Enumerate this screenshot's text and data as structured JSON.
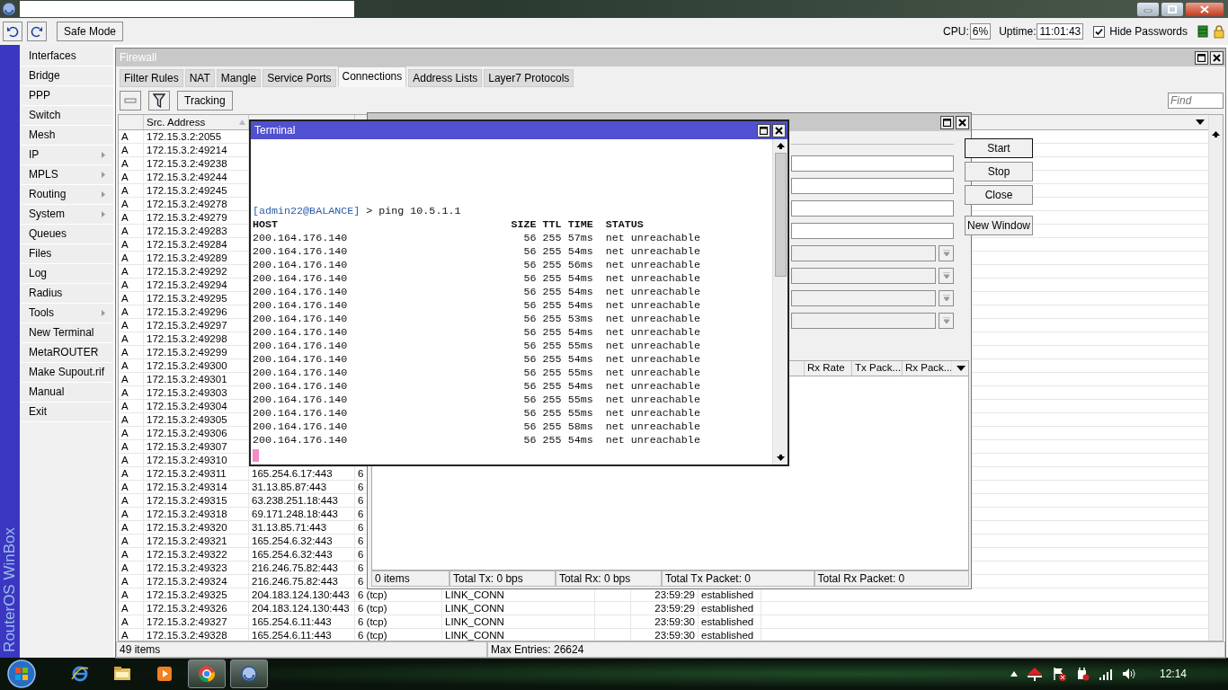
{
  "toolbar": {
    "safe_mode": "Safe Mode",
    "cpu_label": "CPU:",
    "cpu": "6%",
    "uptime_label": "Uptime:",
    "uptime": "11:01:43",
    "hide_passwords": {
      "label": "Hide Passwords",
      "checked": true
    }
  },
  "sidebar": {
    "brand": "RouterOS WinBox",
    "items": [
      {
        "label": "Interfaces",
        "submenu": false
      },
      {
        "label": "Bridge",
        "submenu": false
      },
      {
        "label": "PPP",
        "submenu": false
      },
      {
        "label": "Switch",
        "submenu": false
      },
      {
        "label": "Mesh",
        "submenu": false
      },
      {
        "label": "IP",
        "submenu": true
      },
      {
        "label": "MPLS",
        "submenu": true
      },
      {
        "label": "Routing",
        "submenu": true
      },
      {
        "label": "System",
        "submenu": true
      },
      {
        "label": "Queues",
        "submenu": false
      },
      {
        "label": "Files",
        "submenu": false
      },
      {
        "label": "Log",
        "submenu": false
      },
      {
        "label": "Radius",
        "submenu": false
      },
      {
        "label": "Tools",
        "submenu": true
      },
      {
        "label": "New Terminal",
        "submenu": false
      },
      {
        "label": "MetaROUTER",
        "submenu": false
      },
      {
        "label": "Make Supout.rif",
        "submenu": false
      },
      {
        "label": "Manual",
        "submenu": false
      },
      {
        "label": "Exit",
        "submenu": false
      }
    ]
  },
  "firewall": {
    "title": "Firewall",
    "tabs": [
      {
        "label": "Filter Rules",
        "selected": false
      },
      {
        "label": "NAT",
        "selected": false
      },
      {
        "label": "Mangle",
        "selected": false
      },
      {
        "label": "Service Ports",
        "selected": false
      },
      {
        "label": "Connections",
        "selected": true
      },
      {
        "label": "Address Lists",
        "selected": false
      },
      {
        "label": "Layer7 Protocols",
        "selected": false
      }
    ],
    "tracking_button": "Tracking",
    "find": {
      "placeholder": "Find"
    },
    "src_header": "Src. Address",
    "rows": [
      {
        "flag": "A",
        "src": "172.15.3.2:2055"
      },
      {
        "flag": "A",
        "src": "172.15.3.2:49214"
      },
      {
        "flag": "A",
        "src": "172.15.3.2:49238"
      },
      {
        "flag": "A",
        "src": "172.15.3.2:49244"
      },
      {
        "flag": "A",
        "src": "172.15.3.2:49245"
      },
      {
        "flag": "A",
        "src": "172.15.3.2:49278"
      },
      {
        "flag": "A",
        "src": "172.15.3.2:49279"
      },
      {
        "flag": "A",
        "src": "172.15.3.2:49283"
      },
      {
        "flag": "A",
        "src": "172.15.3.2:49284"
      },
      {
        "flag": "A",
        "src": "172.15.3.2:49289"
      },
      {
        "flag": "A",
        "src": "172.15.3.2:49292"
      },
      {
        "flag": "A",
        "src": "172.15.3.2:49294"
      },
      {
        "flag": "A",
        "src": "172.15.3.2:49295"
      },
      {
        "flag": "A",
        "src": "172.15.3.2:49296"
      },
      {
        "flag": "A",
        "src": "172.15.3.2:49297"
      },
      {
        "flag": "A",
        "src": "172.15.3.2:49298"
      },
      {
        "flag": "A",
        "src": "172.15.3.2:49299"
      },
      {
        "flag": "A",
        "src": "172.15.3.2:49300"
      },
      {
        "flag": "A",
        "src": "172.15.3.2:49301"
      },
      {
        "flag": "A",
        "src": "172.15.3.2:49303"
      },
      {
        "flag": "A",
        "src": "172.15.3.2:49304"
      },
      {
        "flag": "A",
        "src": "172.15.3.2:49305"
      },
      {
        "flag": "A",
        "src": "172.15.3.2:49306"
      },
      {
        "flag": "A",
        "src": "172.15.3.2:49307"
      },
      {
        "flag": "A",
        "src": "172.15.3.2:49310"
      },
      {
        "flag": "A",
        "src": "172.15.3.2:49311",
        "dst": "165.254.6.17:443",
        "proto": "6"
      },
      {
        "flag": "A",
        "src": "172.15.3.2:49314",
        "dst": "31.13.85.87:443",
        "proto": "6"
      },
      {
        "flag": "A",
        "src": "172.15.3.2:49315",
        "dst": "63.238.251.18:443",
        "proto": "6"
      },
      {
        "flag": "A",
        "src": "172.15.3.2:49318",
        "dst": "69.171.248.18:443",
        "proto": "6"
      },
      {
        "flag": "A",
        "src": "172.15.3.2:49320",
        "dst": "31.13.85.71:443",
        "proto": "6"
      },
      {
        "flag": "A",
        "src": "172.15.3.2:49321",
        "dst": "165.254.6.32:443",
        "proto": "6"
      },
      {
        "flag": "A",
        "src": "172.15.3.2:49322",
        "dst": "165.254.6.32:443",
        "proto": "6"
      },
      {
        "flag": "A",
        "src": "172.15.3.2:49323",
        "dst": "216.246.75.82:443",
        "proto": "6"
      },
      {
        "flag": "A",
        "src": "172.15.3.2:49324",
        "dst": "216.246.75.82:443",
        "proto": "6"
      },
      {
        "flag": "A",
        "src": "172.15.3.2:49325",
        "dst": "204.183.124.130:443",
        "proto": "6 (tcp)",
        "mark": "LINK_CONN",
        "timeout": "23:59:29",
        "state": "established"
      },
      {
        "flag": "A",
        "src": "172.15.3.2:49326",
        "dst": "204.183.124.130:443",
        "proto": "6 (tcp)",
        "mark": "LINK_CONN",
        "timeout": "23:59:29",
        "state": "established"
      },
      {
        "flag": "A",
        "src": "172.15.3.2:49327",
        "dst": "165.254.6.11:443",
        "proto": "6 (tcp)",
        "mark": "LINK_CONN",
        "timeout": "23:59:30",
        "state": "established"
      },
      {
        "flag": "A",
        "src": "172.15.3.2:49328",
        "dst": "165.254.6.11:443",
        "proto": "6 (tcp)",
        "mark": "LINK_CONN",
        "timeout": "23:59:30",
        "state": "established"
      }
    ],
    "status": {
      "items": "49 items",
      "max_entries": "Max Entries: 26624"
    }
  },
  "traffic_window": {
    "buttons": [
      {
        "label": "Start",
        "default": true
      },
      {
        "label": "Stop",
        "default": false
      },
      {
        "label": "Close",
        "default": false
      },
      {
        "label": "New Window",
        "default": false
      }
    ],
    "columns": [
      "Rx Rate",
      "Tx Pack...",
      "Rx Pack..."
    ],
    "status": [
      "0 items",
      "Total Tx: 0 bps",
      "Total Rx: 0 bps",
      "Total Tx Packet: 0",
      "Total Rx Packet: 0"
    ]
  },
  "terminal": {
    "title": "Terminal",
    "prompt": "[admin22@BALANCE]",
    "command": "> ping 10.5.1.1",
    "header": {
      "host": "HOST",
      "size": "SIZE",
      "ttl": "TTL",
      "time": "TIME",
      "status": "STATUS"
    },
    "rows": [
      {
        "host": "200.164.176.140",
        "size": "56",
        "ttl": "255",
        "time": "57ms",
        "status": "net unreachable"
      },
      {
        "host": "200.164.176.140",
        "size": "56",
        "ttl": "255",
        "time": "54ms",
        "status": "net unreachable"
      },
      {
        "host": "200.164.176.140",
        "size": "56",
        "ttl": "255",
        "time": "56ms",
        "status": "net unreachable"
      },
      {
        "host": "200.164.176.140",
        "size": "56",
        "ttl": "255",
        "time": "54ms",
        "status": "net unreachable"
      },
      {
        "host": "200.164.176.140",
        "size": "56",
        "ttl": "255",
        "time": "54ms",
        "status": "net unreachable"
      },
      {
        "host": "200.164.176.140",
        "size": "56",
        "ttl": "255",
        "time": "54ms",
        "status": "net unreachable"
      },
      {
        "host": "200.164.176.140",
        "size": "56",
        "ttl": "255",
        "time": "53ms",
        "status": "net unreachable"
      },
      {
        "host": "200.164.176.140",
        "size": "56",
        "ttl": "255",
        "time": "54ms",
        "status": "net unreachable"
      },
      {
        "host": "200.164.176.140",
        "size": "56",
        "ttl": "255",
        "time": "55ms",
        "status": "net unreachable"
      },
      {
        "host": "200.164.176.140",
        "size": "56",
        "ttl": "255",
        "time": "54ms",
        "status": "net unreachable"
      },
      {
        "host": "200.164.176.140",
        "size": "56",
        "ttl": "255",
        "time": "55ms",
        "status": "net unreachable"
      },
      {
        "host": "200.164.176.140",
        "size": "56",
        "ttl": "255",
        "time": "54ms",
        "status": "net unreachable"
      },
      {
        "host": "200.164.176.140",
        "size": "56",
        "ttl": "255",
        "time": "55ms",
        "status": "net unreachable"
      },
      {
        "host": "200.164.176.140",
        "size": "56",
        "ttl": "255",
        "time": "55ms",
        "status": "net unreachable"
      },
      {
        "host": "200.164.176.140",
        "size": "56",
        "ttl": "255",
        "time": "58ms",
        "status": "net unreachable"
      },
      {
        "host": "200.164.176.140",
        "size": "56",
        "ttl": "255",
        "time": "54ms",
        "status": "net unreachable"
      }
    ]
  },
  "taskbar": {
    "clock": "12:14",
    "apps": [
      {
        "kind": "ie",
        "running": false
      },
      {
        "kind": "explorer",
        "running": false
      },
      {
        "kind": "media",
        "running": false
      },
      {
        "kind": "chrome",
        "running": true
      },
      {
        "kind": "winbox",
        "running": true
      }
    ]
  }
}
